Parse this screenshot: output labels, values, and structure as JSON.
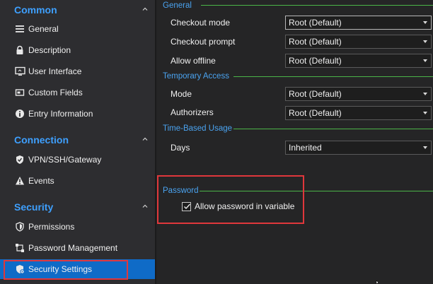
{
  "sidebar": {
    "sections": [
      {
        "title": "Common",
        "items": [
          {
            "label": "General",
            "icon": "list-icon"
          },
          {
            "label": "Description",
            "icon": "lock-icon"
          },
          {
            "label": "User Interface",
            "icon": "monitor-icon"
          },
          {
            "label": "Custom Fields",
            "icon": "fields-icon"
          },
          {
            "label": "Entry Information",
            "icon": "info-icon"
          }
        ]
      },
      {
        "title": "Connection",
        "items": [
          {
            "label": "VPN/SSH/Gateway",
            "icon": "shield-check-icon"
          },
          {
            "label": "Events",
            "icon": "warning-icon"
          }
        ]
      },
      {
        "title": "Security",
        "items": [
          {
            "label": "Permissions",
            "icon": "shield-icon"
          },
          {
            "label": "Password Management",
            "icon": "password-management-icon"
          },
          {
            "label": "Security Settings",
            "icon": "shield-gear-icon",
            "selected": true
          }
        ]
      }
    ]
  },
  "main": {
    "groups": {
      "general": {
        "title": "General",
        "fields": [
          {
            "label": "Checkout mode",
            "value": "Root (Default)"
          },
          {
            "label": "Checkout prompt",
            "value": "Root (Default)"
          },
          {
            "label": "Allow offline",
            "value": "Root (Default)"
          }
        ]
      },
      "temporary_access": {
        "title": "Temporary Access",
        "fields": [
          {
            "label": "Mode",
            "value": "Root (Default)"
          },
          {
            "label": "Authorizers",
            "value": "Root (Default)"
          }
        ]
      },
      "time_based_usage": {
        "title": "Time-Based Usage",
        "fields": [
          {
            "label": "Days",
            "value": "Inherited"
          }
        ]
      },
      "password": {
        "title": "Password",
        "checkbox": {
          "label": "Allow password in variable",
          "checked": true
        }
      }
    }
  },
  "colors": {
    "accent_blue": "#3ea0ff",
    "selected_bg": "#0f6bc7",
    "group_line": "#4bb548",
    "highlight_red": "#e0373b",
    "sidebar_bg": "#2d2d30",
    "main_bg": "#252526"
  }
}
